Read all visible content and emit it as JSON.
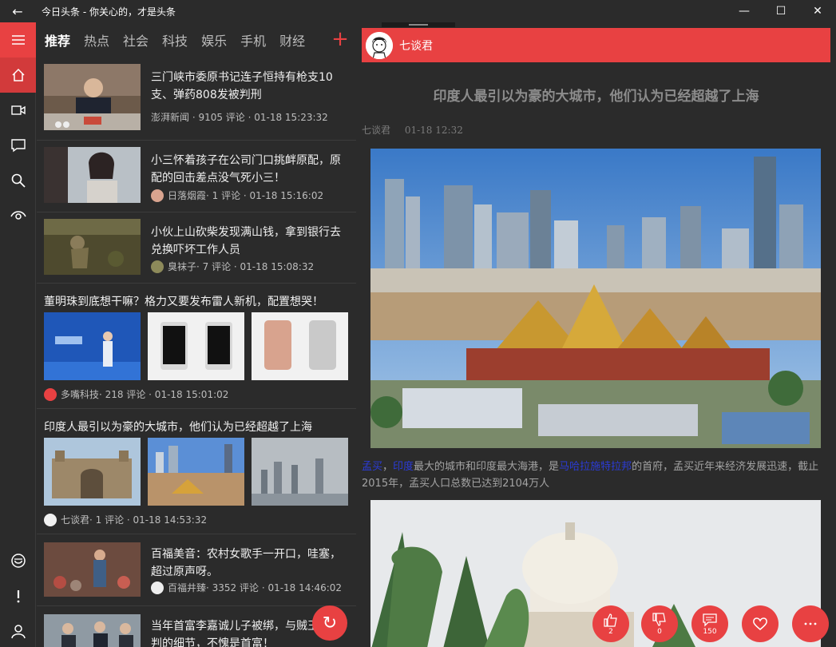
{
  "window": {
    "title": "今日头条 - 你关心的，才是头条",
    "back_icon": "←",
    "minimize": "—",
    "maximize": "☐",
    "close": "✕"
  },
  "rail": {
    "items": [
      "menu-icon",
      "home-icon",
      "video-icon",
      "comment-icon",
      "search-icon",
      "eye-icon",
      "emoji-icon",
      "alert-icon",
      "user-icon"
    ]
  },
  "tabs": {
    "items": [
      "推荐",
      "热点",
      "社会",
      "科技",
      "娱乐",
      "手机",
      "财经"
    ],
    "add": "+"
  },
  "feed": {
    "items": [
      {
        "title": "三门峡市委原书记连子恒持有枪支10支、弹药808发被判刑",
        "meta": "澎湃新闻 · 9105 评论 · 01-18 15:23:32"
      },
      {
        "title": "小三怀着孩子在公司门口挑衅原配，原配的回击差点没气死小三！",
        "author": "日落烟霞",
        "meta": " · 1 评论 · 01-18 15:16:02"
      },
      {
        "title": "小伙上山砍柴发现满山钱，拿到银行去兑换吓坏工作人员",
        "author": "臭袜子",
        "meta": " · 7 评论 · 01-18 15:08:32"
      },
      {
        "title": "董明珠到底想干嘛？格力又要发布雷人新机，配置想哭！",
        "author": "多嘴科技",
        "meta": " · 218 评论 · 01-18 15:01:02"
      },
      {
        "title": "印度人最引以为豪的大城市，他们认为已经超越了上海",
        "author": "七谈君",
        "meta": " · 1 评论 · 01-18 14:53:32"
      },
      {
        "title": "百福美音：农村女歌手一开口，哇塞，超过原声呀。",
        "author": "百福井臻",
        "meta": " · 3352 评论 · 01-18 14:46:02"
      },
      {
        "title": "当年首富李嘉诚儿子被绑，与贼王强谈判的细节，不愧是首富！"
      }
    ],
    "refresh": "↻"
  },
  "article": {
    "author": "七谈君",
    "title": "印度人最引以为豪的大城市，他们认为已经超越了上海",
    "meta_author": "七谈君",
    "meta_time": "01-18 12:32",
    "para_link1": "孟买",
    "para_sep": "，",
    "para_link2": "印度",
    "para_text1": "最大的城市和印度最大海港，是",
    "para_link3": "马哈拉施特拉邦",
    "para_text2": "的首府，孟买近年来经济发展迅速，截止2015年，孟买人口总数已达到2104万人"
  },
  "actions": {
    "like_count": "2",
    "dislike_count": "0",
    "comment_count": "150"
  },
  "colors": {
    "accent": "#e84142",
    "background": "#2b2b2b",
    "link": "#2b3bd6"
  }
}
